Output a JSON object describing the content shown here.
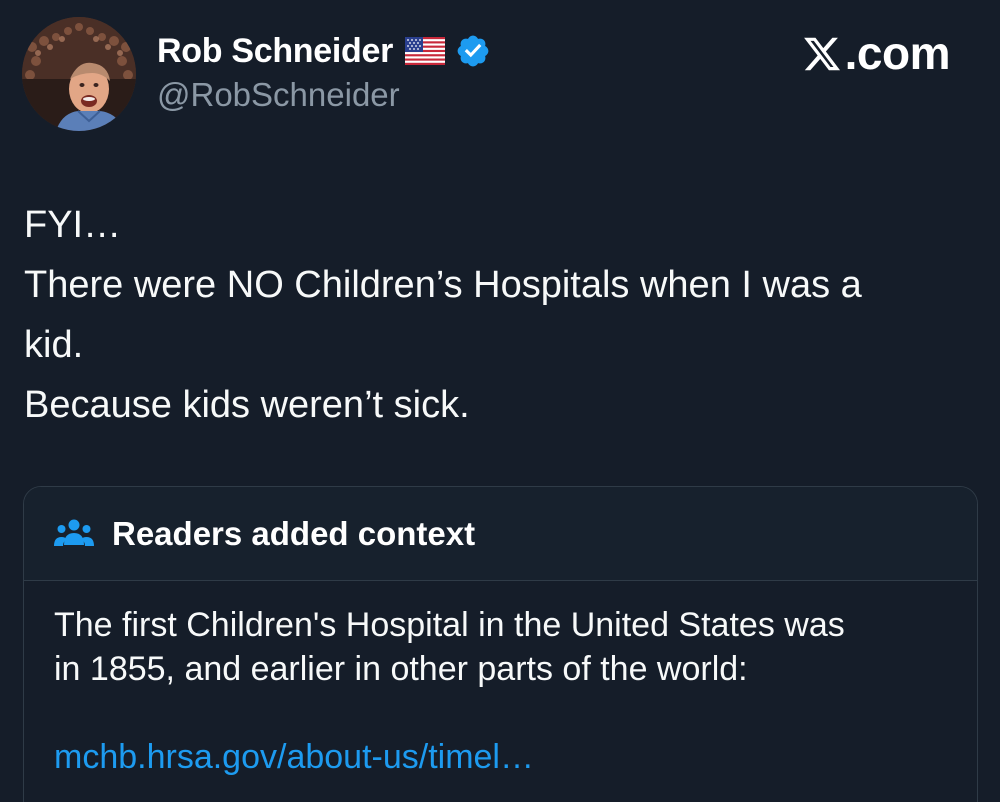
{
  "author": {
    "display_name": "Rob Schneider",
    "handle": "@RobSchneider",
    "badges": [
      "flag-us-icon",
      "verified-badge-icon"
    ],
    "avatar_icon": "avatar-photo"
  },
  "brand": {
    "logo_icon": "x-logo-icon",
    "suffix": ".com"
  },
  "tweet": {
    "lines": [
      "FYI…",
      "There were NO Children’s Hospitals when I was a",
      "kid.",
      "Because kids weren’t sick."
    ]
  },
  "community_note": {
    "icon": "people-icon",
    "title": "Readers added context",
    "body_lines": [
      "The first Children's Hospital in the United States was",
      "in 1855, and earlier in other parts of the world:"
    ],
    "link_text": "mchb.hrsa.gov/about-us/timel…"
  },
  "colors": {
    "background": "#151d29",
    "text": "#f7f9f9",
    "secondary_text": "#8b98a5",
    "link": "#1d9bf0",
    "verified": "#1d9bf0",
    "border": "#2f3b47"
  }
}
